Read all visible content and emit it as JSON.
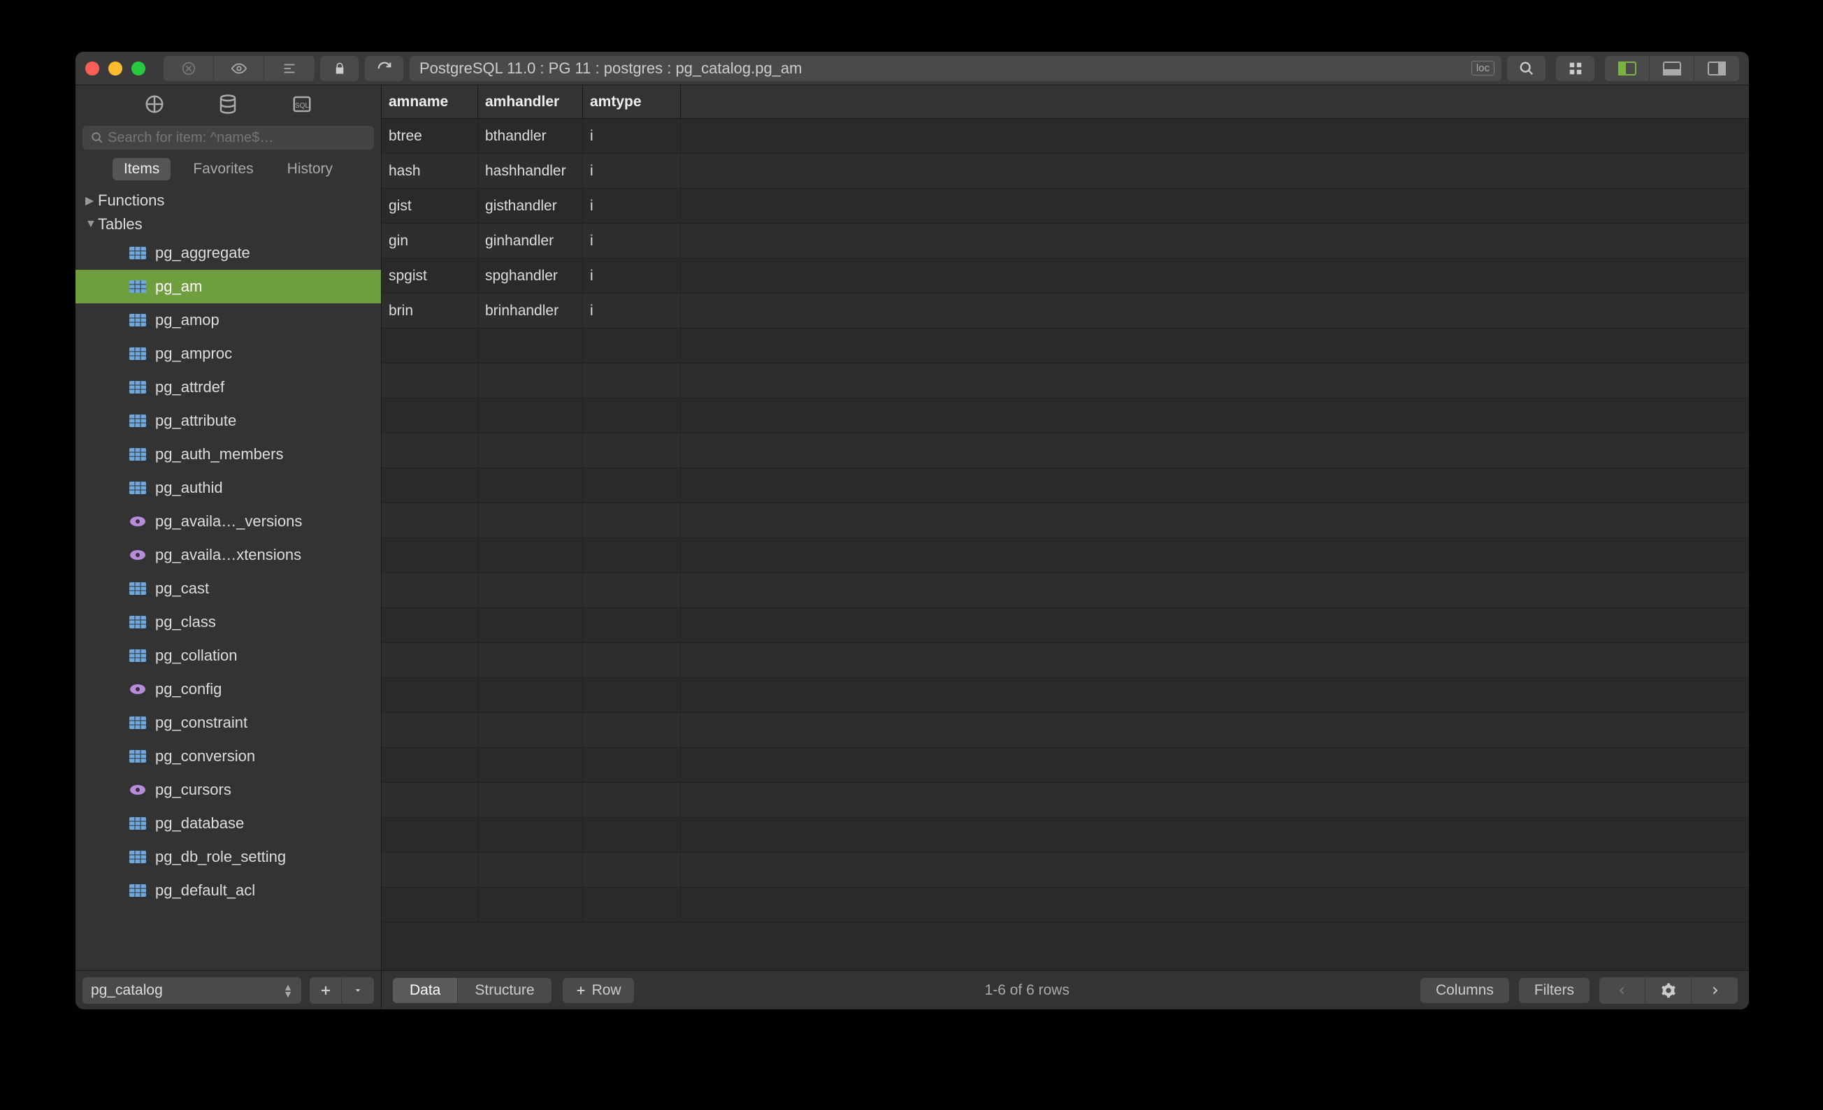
{
  "titlebar": {
    "breadcrumb": "PostgreSQL 11.0 : PG 11 : postgres : pg_catalog.pg_am",
    "loc_badge": "loc"
  },
  "sidebar": {
    "search_placeholder": "Search for item: ^name$…",
    "tabs": {
      "items": "Items",
      "favorites": "Favorites",
      "history": "History"
    },
    "sections": {
      "functions": "Functions",
      "tables": "Tables"
    },
    "tables": [
      {
        "name": "pg_aggregate",
        "type": "table"
      },
      {
        "name": "pg_am",
        "type": "table",
        "selected": true
      },
      {
        "name": "pg_amop",
        "type": "table"
      },
      {
        "name": "pg_amproc",
        "type": "table"
      },
      {
        "name": "pg_attrdef",
        "type": "table"
      },
      {
        "name": "pg_attribute",
        "type": "table"
      },
      {
        "name": "pg_auth_members",
        "type": "table"
      },
      {
        "name": "pg_authid",
        "type": "table"
      },
      {
        "name": "pg_availa…_versions",
        "type": "view"
      },
      {
        "name": "pg_availa…xtensions",
        "type": "view"
      },
      {
        "name": "pg_cast",
        "type": "table"
      },
      {
        "name": "pg_class",
        "type": "table"
      },
      {
        "name": "pg_collation",
        "type": "table"
      },
      {
        "name": "pg_config",
        "type": "view"
      },
      {
        "name": "pg_constraint",
        "type": "table"
      },
      {
        "name": "pg_conversion",
        "type": "table"
      },
      {
        "name": "pg_cursors",
        "type": "view"
      },
      {
        "name": "pg_database",
        "type": "table"
      },
      {
        "name": "pg_db_role_setting",
        "type": "table"
      },
      {
        "name": "pg_default_acl",
        "type": "table"
      }
    ],
    "schema": "pg_catalog"
  },
  "grid": {
    "columns": [
      "amname",
      "amhandler",
      "amtype"
    ],
    "rows": [
      {
        "amname": "btree",
        "amhandler": "bthandler",
        "amtype": "i"
      },
      {
        "amname": "hash",
        "amhandler": "hashhandler",
        "amtype": "i"
      },
      {
        "amname": "gist",
        "amhandler": "gisthandler",
        "amtype": "i"
      },
      {
        "amname": "gin",
        "amhandler": "ginhandler",
        "amtype": "i"
      },
      {
        "amname": "spgist",
        "amhandler": "spghandler",
        "amtype": "i"
      },
      {
        "amname": "brin",
        "amhandler": "brinhandler",
        "amtype": "i"
      }
    ]
  },
  "footer": {
    "data": "Data",
    "structure": "Structure",
    "row": "Row",
    "status": "1-6 of 6 rows",
    "columns": "Columns",
    "filters": "Filters"
  }
}
